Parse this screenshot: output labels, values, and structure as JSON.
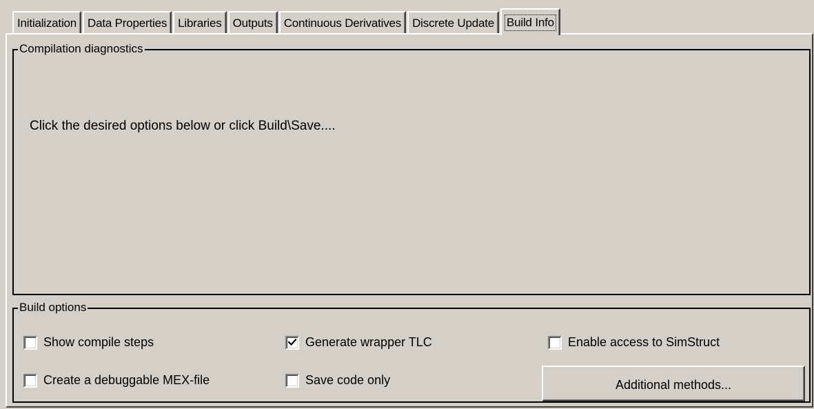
{
  "tabs": [
    {
      "label": "Initialization",
      "active": false
    },
    {
      "label": "Data Properties",
      "active": false
    },
    {
      "label": "Libraries",
      "active": false
    },
    {
      "label": "Outputs",
      "active": false
    },
    {
      "label": "Continuous Derivatives",
      "active": false
    },
    {
      "label": "Discrete Update",
      "active": false
    },
    {
      "label": "Build Info",
      "active": true
    }
  ],
  "diagnostics": {
    "title": "Compilation diagnostics",
    "message": "Click the desired options below or click Build\\Save...."
  },
  "build_options": {
    "title": "Build options",
    "show_compile_steps": {
      "label": "Show compile steps",
      "checked": false
    },
    "create_debuggable_mex": {
      "label": "Create a debuggable MEX-file",
      "checked": false
    },
    "generate_wrapper_tlc": {
      "label": "Generate wrapper TLC",
      "checked": true
    },
    "save_code_only": {
      "label": "Save code only",
      "checked": false
    },
    "enable_simstruct_access": {
      "label": "Enable access to SimStruct",
      "checked": false
    },
    "additional_methods_label": "Additional methods..."
  },
  "colors": {
    "face": "#d4d0c8",
    "highlight": "#ffffff",
    "shadow": "#808080",
    "dark_shadow": "#404040"
  }
}
